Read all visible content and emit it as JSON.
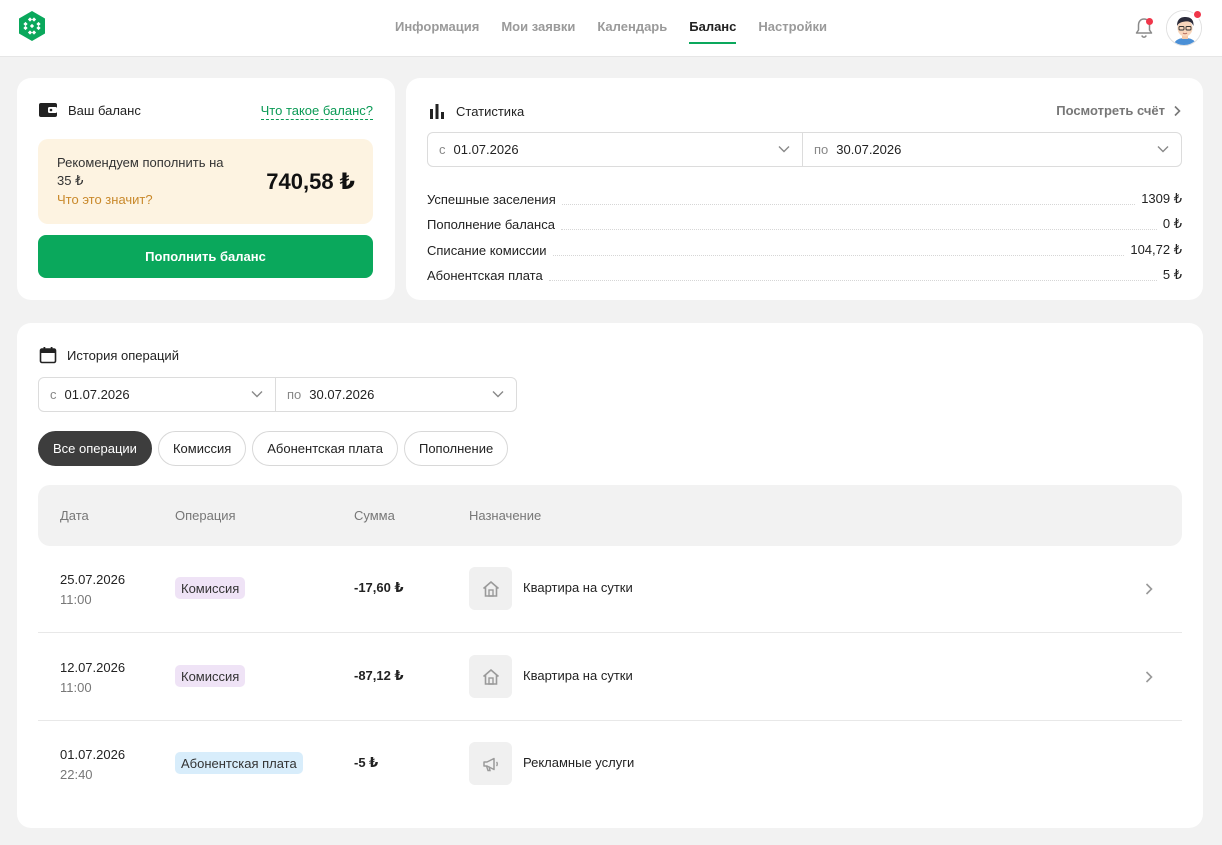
{
  "nav": {
    "items": [
      {
        "label": "Информация",
        "active": false
      },
      {
        "label": "Мои заявки",
        "active": false
      },
      {
        "label": "Календарь",
        "active": false
      },
      {
        "label": "Баланс",
        "active": true
      },
      {
        "label": "Настройки",
        "active": false
      }
    ]
  },
  "colors": {
    "accent": "#0aa85c",
    "notification": "#f0364a",
    "warning_bg": "#fdf3e1",
    "warning_link": "#c9892b"
  },
  "balance": {
    "title": "Ваш баланс",
    "what_is_link": "Что такое баланс?",
    "recommend_text": "Рекомендуем пополнить на 35 ₺",
    "recommend_link": "Что это значит?",
    "amount": "740,58 ₺",
    "topup_button": "Пополнить баланс"
  },
  "stats": {
    "title": "Статистика",
    "see_bill": "Посмотреть счёт",
    "from_prefix": "с",
    "from_value": "01.07.2026",
    "to_prefix": "по",
    "to_value": "30.07.2026",
    "rows": [
      {
        "label": "Успешные заселения",
        "value": "1309 ₺"
      },
      {
        "label": "Пополнение баланса",
        "value": "0 ₺"
      },
      {
        "label": "Списание комиссии",
        "value": "104,72 ₺"
      },
      {
        "label": "Абонентская плата",
        "value": "5 ₺"
      }
    ]
  },
  "history": {
    "title": "История операций",
    "from_prefix": "с",
    "from_value": "01.07.2026",
    "to_prefix": "по",
    "to_value": "30.07.2026",
    "filters": [
      {
        "label": "Все операции",
        "active": true
      },
      {
        "label": "Комиссия",
        "active": false
      },
      {
        "label": "Абонентская плата",
        "active": false
      },
      {
        "label": "Пополнение",
        "active": false
      }
    ],
    "columns": {
      "date": "Дата",
      "operation": "Операция",
      "sum": "Сумма",
      "purpose": "Назначение"
    },
    "rows": [
      {
        "date": "25.07.2026",
        "time": "11:00",
        "operation": "Комиссия",
        "sum": "-17,60 ₺",
        "purpose": "Квартира на сутки",
        "icon": "house-icon"
      },
      {
        "date": "12.07.2026",
        "time": "11:00",
        "operation": "Комиссия",
        "sum": "-87,12 ₺",
        "purpose": "Квартира на сутки",
        "icon": "house-icon"
      },
      {
        "date": "01.07.2026",
        "time": "22:40",
        "operation": "Абонентская плата",
        "sum": "-5 ₺",
        "purpose": "Рекламные услуги",
        "icon": "megaphone-icon"
      }
    ]
  }
}
